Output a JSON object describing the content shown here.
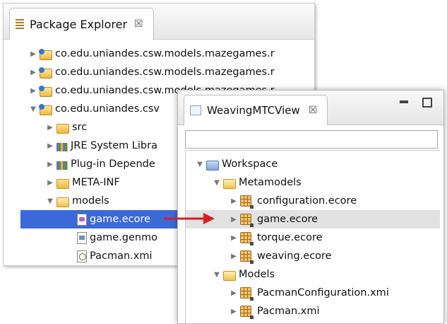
{
  "package_explorer": {
    "tab_label": "Package Explorer",
    "tab_close": "☒",
    "items": [
      {
        "label": "co.edu.uniandes.csw.models.mazegames.r",
        "twisty": "▶"
      },
      {
        "label": "co.edu.uniandes.csw.models.mazegames.r",
        "twisty": "▶"
      },
      {
        "label": "co.edu.uniandes.csw.models.mazegames.r",
        "twisty": "▶"
      },
      {
        "label": "co.edu.uniandes.csv",
        "twisty": "▼"
      },
      {
        "label": "src",
        "twisty": "▶"
      },
      {
        "label": "JRE System Libra",
        "twisty": "▶"
      },
      {
        "label": "Plug-in Depende",
        "twisty": "▶"
      },
      {
        "label": "META-INF",
        "twisty": "▶"
      },
      {
        "label": "models",
        "twisty": "▼"
      },
      {
        "label": "game.ecore",
        "twisty": ""
      },
      {
        "label": "game.genmo",
        "twisty": ""
      },
      {
        "label": "Pacman.xmi",
        "twisty": ""
      }
    ]
  },
  "weaving_view": {
    "tab_label": "WeavingMTCView",
    "tab_close": "☒",
    "filter_value": "",
    "tree": [
      {
        "label": "Workspace",
        "twisty": "▼"
      },
      {
        "label": "Metamodels",
        "twisty": "▼"
      },
      {
        "label": "configuration.ecore",
        "twisty": "▶"
      },
      {
        "label": "game.ecore",
        "twisty": "▶"
      },
      {
        "label": "torque.ecore",
        "twisty": "▶"
      },
      {
        "label": "weaving.ecore",
        "twisty": "▶"
      },
      {
        "label": "Models",
        "twisty": "▼"
      },
      {
        "label": "PacmanConfiguration.xmi",
        "twisty": "▶"
      },
      {
        "label": "Pacman.xmi",
        "twisty": "▶"
      }
    ]
  },
  "colors": {
    "selection": "#3c69d9",
    "highlight": "#e2e2e2",
    "arrow": "#d61f1f"
  }
}
